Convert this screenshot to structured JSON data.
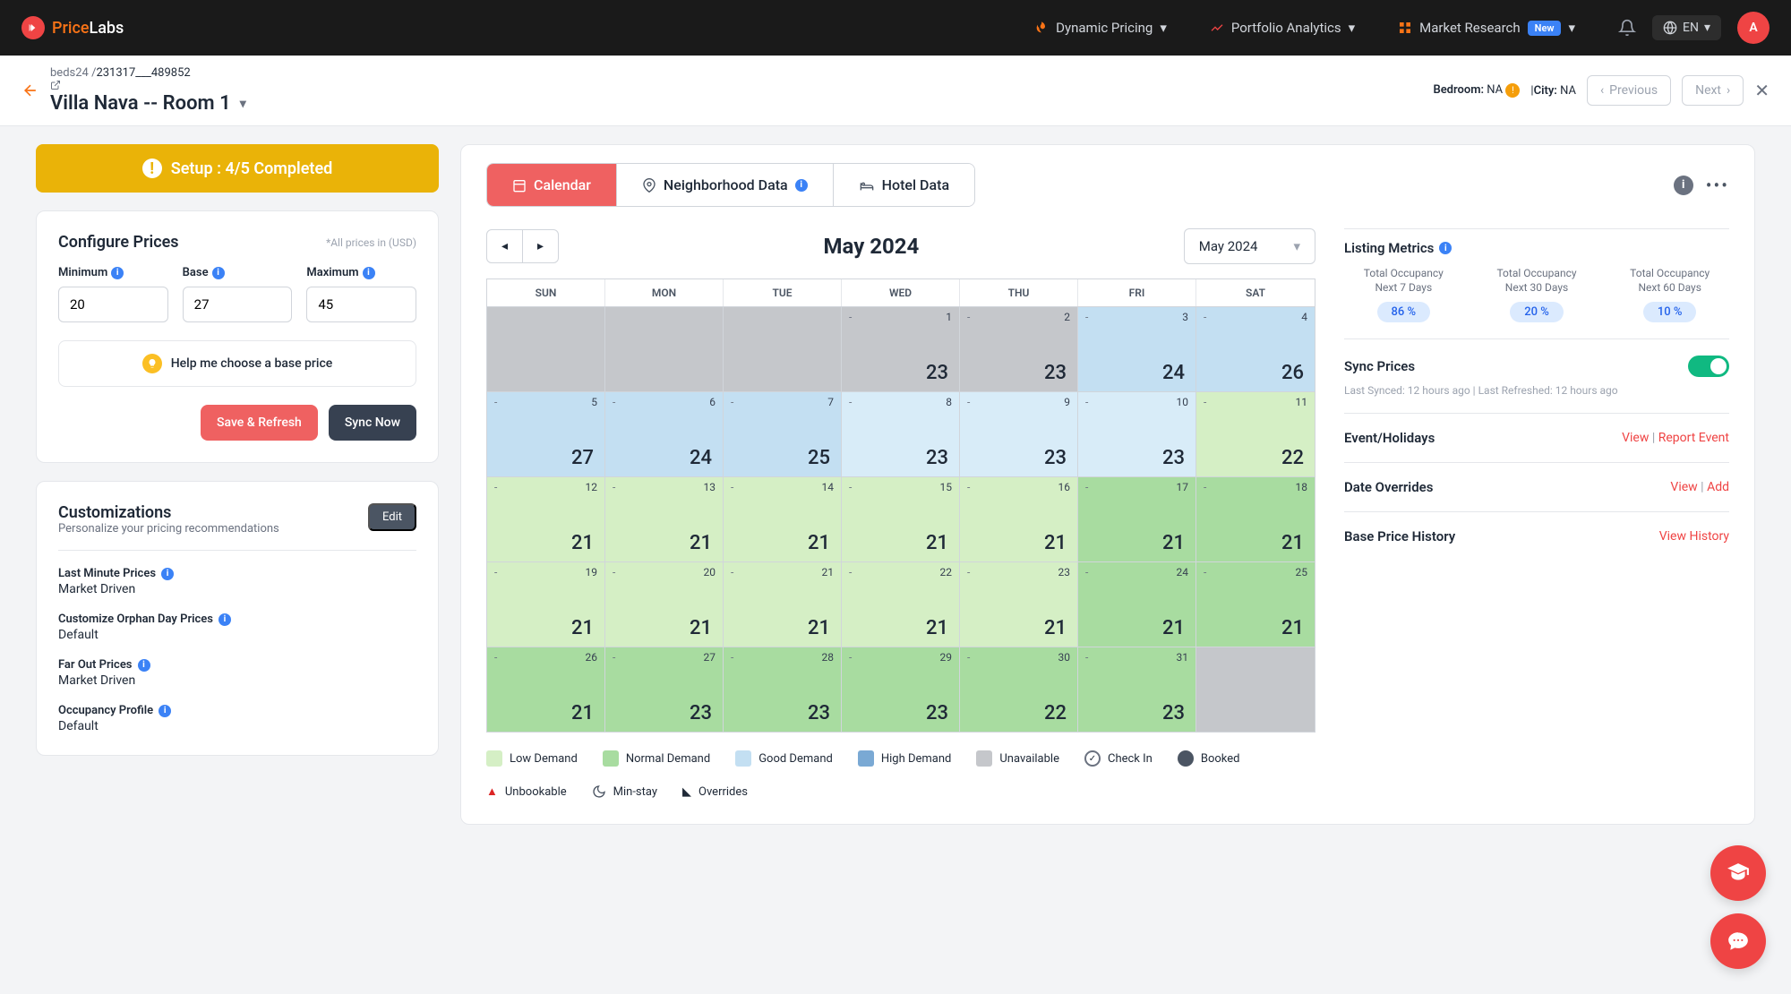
{
  "brand": {
    "part1": "Price",
    "part2": "Labs"
  },
  "nav": {
    "dynamic": "Dynamic Pricing",
    "portfolio": "Portfolio Analytics",
    "market": "Market Research",
    "new_badge": "New"
  },
  "lang": "EN",
  "avatar_letter": "A",
  "breadcrumb": {
    "prefix": "beds24 /",
    "id": "231317___489852"
  },
  "listing_title": "Villa Nava -- Room 1",
  "meta": {
    "bedroom_label": "Bedroom:",
    "bedroom_value": "NA",
    "city_label": "City:",
    "city_value": "NA",
    "prev": "Previous",
    "next": "Next"
  },
  "setup": "Setup : 4/5 Completed",
  "configure": {
    "title": "Configure Prices",
    "currency_note": "*All prices in (USD)",
    "min_label": "Minimum",
    "base_label": "Base",
    "max_label": "Maximum",
    "min_val": "20",
    "base_val": "27",
    "max_val": "45",
    "help": "Help me choose a base price",
    "save": "Save & Refresh",
    "sync": "Sync Now"
  },
  "customizations": {
    "title": "Customizations",
    "subtitle": "Personalize your pricing recommendations",
    "edit": "Edit",
    "items": [
      {
        "label": "Last Minute Prices",
        "value": "Market Driven"
      },
      {
        "label": "Customize Orphan Day Prices",
        "value": "Default"
      },
      {
        "label": "Far Out Prices",
        "value": "Market Driven"
      },
      {
        "label": "Occupancy Profile",
        "value": "Default"
      }
    ]
  },
  "tabs": {
    "calendar": "Calendar",
    "neighborhood": "Neighborhood Data",
    "hotel": "Hotel Data"
  },
  "month_title": "May 2024",
  "month_select": "May 2024",
  "days": [
    "SUN",
    "MON",
    "TUE",
    "WED",
    "THU",
    "FRI",
    "SAT"
  ],
  "cells": [
    {
      "cls": "unavail"
    },
    {
      "cls": "unavail"
    },
    {
      "cls": "unavail"
    },
    {
      "cls": "unavail",
      "date": "1",
      "dash": "-",
      "price": "23"
    },
    {
      "cls": "unavail",
      "date": "2",
      "dash": "-",
      "price": "23"
    },
    {
      "cls": "good",
      "date": "3",
      "dash": "-",
      "price": "24"
    },
    {
      "cls": "good",
      "date": "4",
      "dash": "-",
      "price": "26"
    },
    {
      "cls": "good",
      "date": "5",
      "dash": "-",
      "price": "27"
    },
    {
      "cls": "good",
      "date": "6",
      "dash": "-",
      "price": "24"
    },
    {
      "cls": "good",
      "date": "7",
      "dash": "-",
      "price": "25"
    },
    {
      "cls": "good-light",
      "date": "8",
      "dash": "-",
      "price": "23"
    },
    {
      "cls": "good-light",
      "date": "9",
      "dash": "-",
      "price": "23"
    },
    {
      "cls": "good-light",
      "date": "10",
      "dash": "-",
      "price": "23"
    },
    {
      "cls": "low",
      "date": "11",
      "dash": "-",
      "price": "22"
    },
    {
      "cls": "low",
      "date": "12",
      "dash": "-",
      "price": "21"
    },
    {
      "cls": "low",
      "date": "13",
      "dash": "-",
      "price": "21"
    },
    {
      "cls": "low",
      "date": "14",
      "dash": "-",
      "price": "21"
    },
    {
      "cls": "low",
      "date": "15",
      "dash": "-",
      "price": "21"
    },
    {
      "cls": "low",
      "date": "16",
      "dash": "-",
      "price": "21"
    },
    {
      "cls": "normal",
      "date": "17",
      "dash": "-",
      "price": "21"
    },
    {
      "cls": "normal",
      "date": "18",
      "dash": "-",
      "price": "21"
    },
    {
      "cls": "low",
      "date": "19",
      "dash": "-",
      "price": "21"
    },
    {
      "cls": "low",
      "date": "20",
      "dash": "-",
      "price": "21"
    },
    {
      "cls": "low",
      "date": "21",
      "dash": "-",
      "price": "21"
    },
    {
      "cls": "low",
      "date": "22",
      "dash": "-",
      "price": "21"
    },
    {
      "cls": "low",
      "date": "23",
      "dash": "-",
      "price": "21"
    },
    {
      "cls": "normal",
      "date": "24",
      "dash": "-",
      "price": "21"
    },
    {
      "cls": "normal",
      "date": "25",
      "dash": "-",
      "price": "21"
    },
    {
      "cls": "normal",
      "date": "26",
      "dash": "-",
      "price": "21"
    },
    {
      "cls": "normal",
      "date": "27",
      "dash": "-",
      "price": "23"
    },
    {
      "cls": "normal",
      "date": "28",
      "dash": "-",
      "price": "23"
    },
    {
      "cls": "normal",
      "date": "29",
      "dash": "-",
      "price": "23"
    },
    {
      "cls": "normal",
      "date": "30",
      "dash": "-",
      "price": "22"
    },
    {
      "cls": "normal",
      "date": "31",
      "dash": "-",
      "price": "23"
    },
    {
      "cls": "empty"
    }
  ],
  "legend": {
    "low": "Low Demand",
    "normal": "Normal Demand",
    "good": "Good Demand",
    "high": "High Demand",
    "unavail": "Unavailable",
    "checkin": "Check In",
    "booked": "Booked",
    "unbookable": "Unbookable",
    "minstay": "Min-stay",
    "overrides": "Overrides"
  },
  "metrics": {
    "title": "Listing Metrics",
    "occ": [
      {
        "label1": "Total Occupancy",
        "label2": "Next 7 Days",
        "value": "86 %"
      },
      {
        "label1": "Total Occupancy",
        "label2": "Next 30 Days",
        "value": "20 %"
      },
      {
        "label1": "Total Occupancy",
        "label2": "Next 60 Days",
        "value": "10 %"
      }
    ],
    "sync_title": "Sync Prices",
    "sync_meta": "Last Synced: 12 hours ago | Last Refreshed: 12 hours ago",
    "event_title": "Event/Holidays",
    "view": "View",
    "report": "Report Event",
    "overrides_title": "Date Overrides",
    "add": "Add",
    "history_title": "Base Price History",
    "view_history": "View History"
  }
}
